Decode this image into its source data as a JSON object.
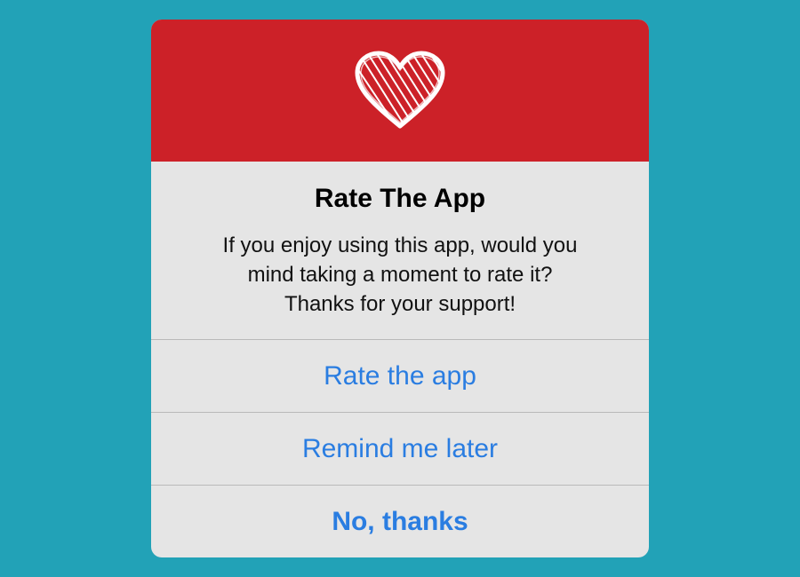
{
  "dialog": {
    "title": "Rate The App",
    "message_lines": [
      "If you enjoy using this app, would you",
      "mind taking a moment to rate it?",
      "Thanks for your support!"
    ],
    "header_icon": "heart-icon",
    "actions": [
      {
        "label": "Rate the app"
      },
      {
        "label": "Remind me later"
      },
      {
        "label": "No, thanks"
      }
    ]
  },
  "colors": {
    "background": "#22a2b7",
    "header": "#cc2128",
    "dialog_body": "#e5e5e5",
    "action_text": "#2a7de1"
  }
}
